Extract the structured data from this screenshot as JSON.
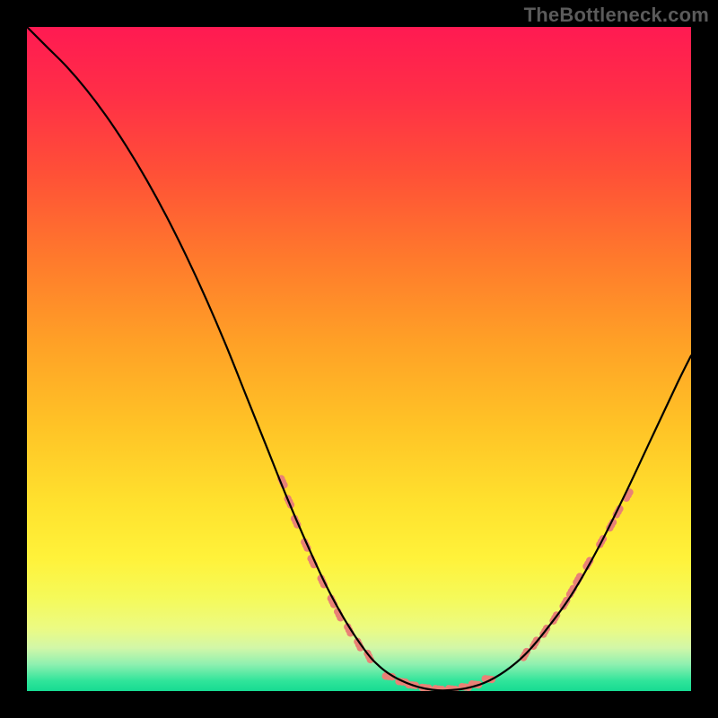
{
  "watermark": "TheBottleneck.com",
  "gradient_stops": [
    {
      "offset": 0.0,
      "color": "#ff1a52"
    },
    {
      "offset": 0.1,
      "color": "#ff2e47"
    },
    {
      "offset": 0.22,
      "color": "#ff5037"
    },
    {
      "offset": 0.35,
      "color": "#ff7a2c"
    },
    {
      "offset": 0.48,
      "color": "#ffa226"
    },
    {
      "offset": 0.6,
      "color": "#ffc326"
    },
    {
      "offset": 0.72,
      "color": "#ffe22e"
    },
    {
      "offset": 0.8,
      "color": "#fff23a"
    },
    {
      "offset": 0.86,
      "color": "#f5fa5a"
    },
    {
      "offset": 0.905,
      "color": "#ecfb82"
    },
    {
      "offset": 0.935,
      "color": "#d2f7a8"
    },
    {
      "offset": 0.96,
      "color": "#8ef0b0"
    },
    {
      "offset": 0.985,
      "color": "#2fe49a"
    },
    {
      "offset": 1.0,
      "color": "#17db92"
    }
  ],
  "curve_color": "#000000",
  "curve_width": 2.2,
  "marker_color": "#e98176",
  "marker_radius_small": 4.2,
  "marker_radius_large": 5.5,
  "chart_data": {
    "type": "line",
    "title": "",
    "xlabel": "",
    "ylabel": "",
    "xlim": [
      0,
      100
    ],
    "ylim": [
      0,
      100
    ],
    "series": [
      {
        "name": "curve",
        "x": [
          0,
          3,
          6,
          9,
          12,
          15,
          18,
          21,
          24,
          27,
          30,
          33,
          36,
          39,
          42,
          45,
          48,
          51,
          53,
          55,
          57,
          59,
          61,
          63,
          66,
          69,
          72,
          75,
          78,
          82,
          86,
          90,
          94,
          98,
          100
        ],
        "y": [
          100,
          97,
          94,
          90.5,
          86.5,
          82,
          77,
          71.5,
          65.5,
          59,
          52,
          44.5,
          37,
          29.5,
          22.5,
          16,
          10.5,
          6,
          3.8,
          2.3,
          1.3,
          0.6,
          0.2,
          0.1,
          0.4,
          1.3,
          3,
          5.5,
          9,
          14.5,
          21.5,
          29.5,
          38,
          46.5,
          50.5
        ]
      }
    ],
    "markers_left": [
      {
        "x": 38.5,
        "y": 31.5
      },
      {
        "x": 39.5,
        "y": 28.5
      },
      {
        "x": 40.5,
        "y": 25.5
      },
      {
        "x": 42.0,
        "y": 22.0
      },
      {
        "x": 43.0,
        "y": 19.5
      },
      {
        "x": 44.5,
        "y": 16.5
      },
      {
        "x": 46.0,
        "y": 13.5
      },
      {
        "x": 47.0,
        "y": 11.5
      },
      {
        "x": 48.5,
        "y": 9.2
      },
      {
        "x": 50.0,
        "y": 7.0
      },
      {
        "x": 51.5,
        "y": 5.2
      }
    ],
    "markers_bottom": [
      {
        "x": 54.5,
        "y": 2.2
      },
      {
        "x": 56.5,
        "y": 1.4
      },
      {
        "x": 58.0,
        "y": 0.9
      },
      {
        "x": 60.0,
        "y": 0.5
      },
      {
        "x": 62.0,
        "y": 0.3
      },
      {
        "x": 64.0,
        "y": 0.3
      },
      {
        "x": 66.0,
        "y": 0.6
      },
      {
        "x": 67.5,
        "y": 1.0
      },
      {
        "x": 69.5,
        "y": 1.8
      }
    ],
    "markers_right": [
      {
        "x": 75.0,
        "y": 5.5
      },
      {
        "x": 76.5,
        "y": 7.2
      },
      {
        "x": 78.0,
        "y": 9.0
      },
      {
        "x": 79.5,
        "y": 11.0
      },
      {
        "x": 81.0,
        "y": 13.2
      },
      {
        "x": 82.0,
        "y": 15.0
      },
      {
        "x": 83.0,
        "y": 16.8
      },
      {
        "x": 84.5,
        "y": 19.2
      },
      {
        "x": 86.5,
        "y": 22.5
      },
      {
        "x": 88.0,
        "y": 25.0
      },
      {
        "x": 89.0,
        "y": 27.0
      },
      {
        "x": 90.5,
        "y": 29.5
      }
    ]
  }
}
